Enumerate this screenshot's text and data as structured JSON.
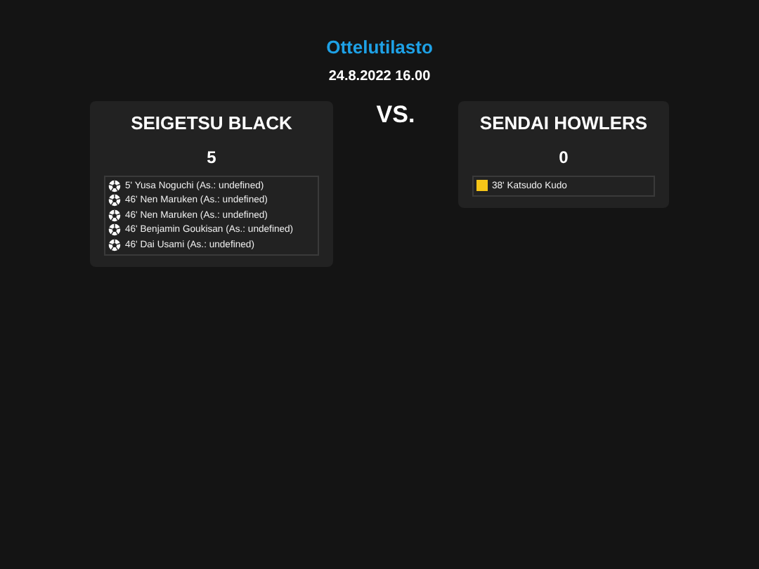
{
  "title": "Ottelutilasto",
  "datetime": "24.8.2022 16.00",
  "vs": "VS.",
  "teams": [
    {
      "name": "SEIGETSU BLACK",
      "score": "5",
      "events": [
        {
          "kind": "goal",
          "text": "5' Yusa Noguchi (As.: undefined)"
        },
        {
          "kind": "goal",
          "text": "46' Nen Maruken (As.: undefined)"
        },
        {
          "kind": "goal",
          "text": "46' Nen Maruken (As.: undefined)"
        },
        {
          "kind": "goal",
          "text": "46' Benjamin Goukisan (As.: undefined)"
        },
        {
          "kind": "goal",
          "text": "46' Dai Usami (As.: undefined)"
        }
      ]
    },
    {
      "name": "SENDAI HOWLERS",
      "score": "0",
      "events": [
        {
          "kind": "yellow_card",
          "text": "38' Katsudo Kudo"
        }
      ]
    }
  ]
}
